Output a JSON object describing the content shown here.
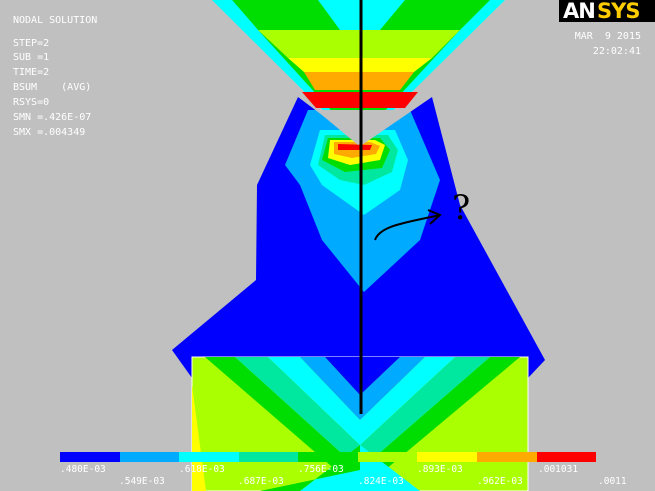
{
  "header": {
    "lines": [
      "NODAL SOLUTION",
      "STEP=2",
      "SUB =1",
      "TIME=2",
      "BSUM    (AVG)",
      "RSYS=0",
      "SMN =.426E-07",
      "SMX =.004349"
    ]
  },
  "date": {
    "date": "MAR  9 2015",
    "time": "22:02:41"
  },
  "logo": {
    "part1": "AN",
    "part2": "SYS"
  },
  "legend": {
    "colors": [
      "#0000ff",
      "#00aaff",
      "#00ffff",
      "#00e8a0",
      "#00dd00",
      "#aaff00",
      "#ffff00",
      "#ffaa00",
      "#ff0000"
    ],
    "top_labels": [
      ".480E-03",
      ".618E-03",
      ".756E-03",
      ".893E-03",
      ".001031"
    ],
    "bottom_labels": [
      ".549E-03",
      ".687E-03",
      ".824E-03",
      ".962E-03",
      ".0011"
    ]
  },
  "annotation": {
    "mark": "?"
  }
}
